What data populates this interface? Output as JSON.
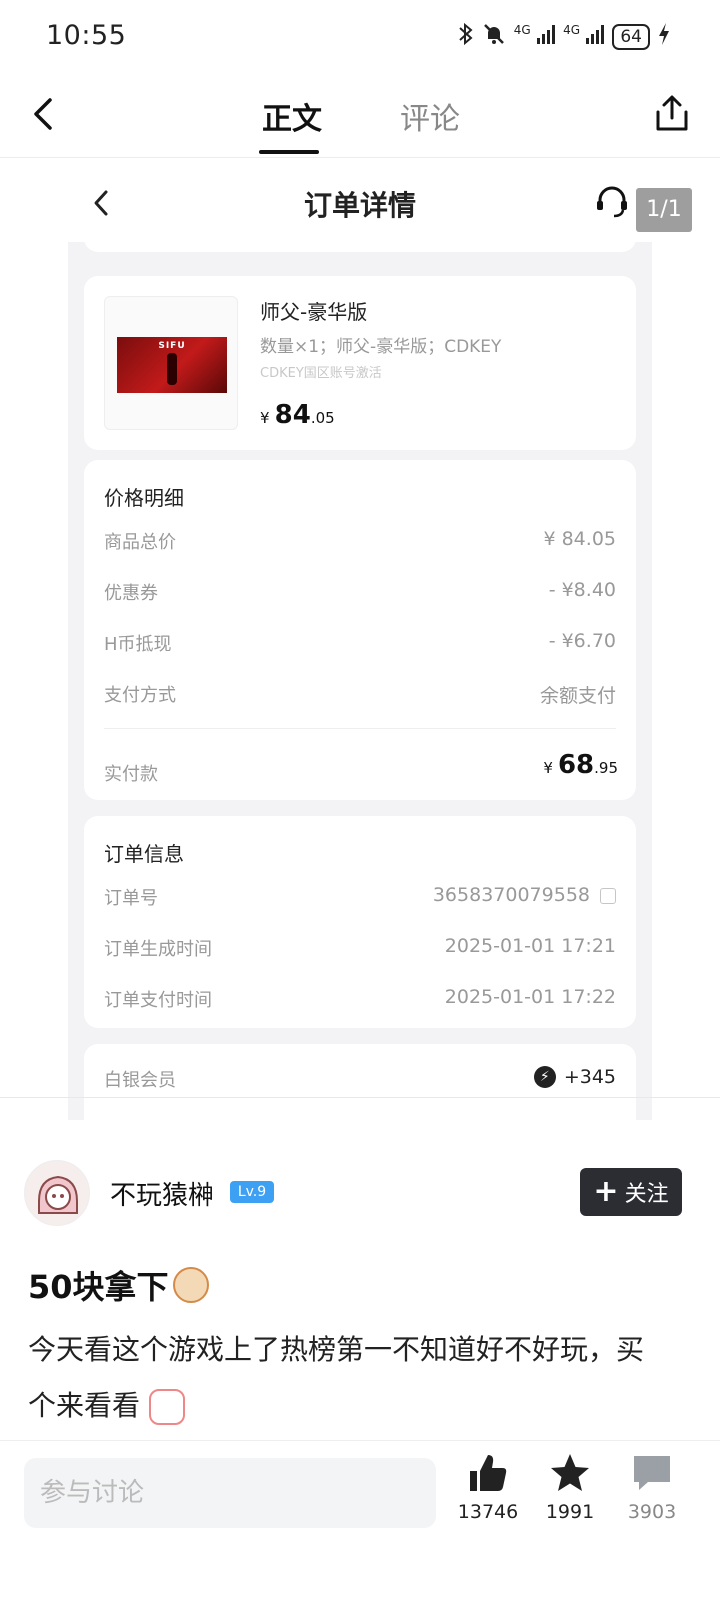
{
  "status_bar": {
    "time": "10:55",
    "net1": "4G",
    "net2": "4G",
    "battery": "64"
  },
  "nav": {
    "tab_main": "正文",
    "tab_comment": "评论"
  },
  "screenshot": {
    "header_title": "订单详情",
    "page_counter": "1/1",
    "product": {
      "thumb_logo": "SIFU",
      "name": "师父-豪华版",
      "spec": "数量×1；师父-豪华版；CDKEY",
      "note": "CDKEY国区账号激活",
      "currency": "¥",
      "price_int": "84",
      "price_dec": ".05"
    },
    "price_detail": {
      "title": "价格明细",
      "rows": [
        {
          "label": "商品总价",
          "value": "¥ 84.05"
        },
        {
          "label": "优惠券",
          "value": "- ¥8.40"
        },
        {
          "label": "H币抵现",
          "value": "- ¥6.70"
        },
        {
          "label": "支付方式",
          "value": "余额支付"
        }
      ],
      "paid_label": "实付款",
      "paid_currency": "¥",
      "paid_int": "68",
      "paid_dec": ".95"
    },
    "order_info": {
      "title": "订单信息",
      "rows": [
        {
          "label": "订单号",
          "value": "3658370079558"
        },
        {
          "label": "订单生成时间",
          "value": "2025-01-01 17:21"
        },
        {
          "label": "订单支付时间",
          "value": "2025-01-01 17:22"
        }
      ]
    },
    "member": {
      "label": "白银会员",
      "value": "+345"
    }
  },
  "author": {
    "name": "不玩猿榊",
    "level": "Lv.9",
    "follow_label": "关注"
  },
  "post": {
    "title": "50块拿下",
    "body": "今天看这个游戏上了热榜第一不知道好不好玩，买个来看看"
  },
  "bottom_bar": {
    "placeholder": "参与讨论",
    "likes": "13746",
    "favorites": "1991",
    "comments": "3903"
  },
  "colors": {
    "level_badge": "#3ea0f2",
    "follow_bg": "#2b2d33",
    "card_bg": "#f3f3f6"
  }
}
